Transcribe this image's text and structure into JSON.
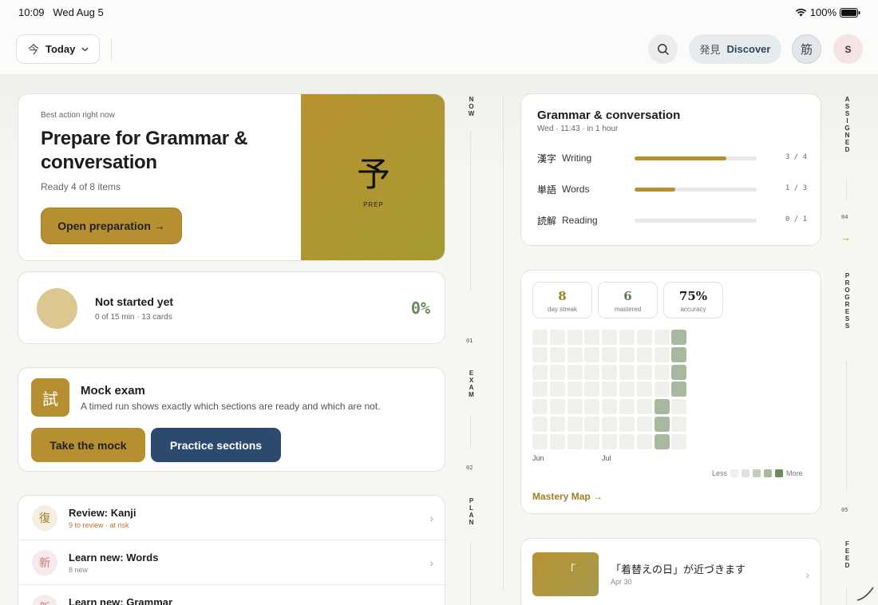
{
  "status": {
    "time": "10:09",
    "date": "Wed Aug 5",
    "battery": "100%"
  },
  "topbar": {
    "today_label": "Today",
    "today_jp": "今",
    "discover_jp": "発見",
    "discover_label": "Discover",
    "kanji_button": "筋",
    "avatar_initial": "S"
  },
  "prep": {
    "eyebrow": "Best action right now",
    "title": "Prepare for Grammar & conversation",
    "subtitle": "Ready 4 of 8 items",
    "button": "Open preparation →",
    "tile_kanji": "予",
    "tile_label": "PREP"
  },
  "progress_status": {
    "title": "Not started yet",
    "subtitle": "0 of 15 min · 13 cards",
    "percent": "0%"
  },
  "mock": {
    "icon": "試",
    "title": "Mock exam",
    "subtitle": "A timed run shows exactly which sections are ready and which are not.",
    "primary_button": "Take the mock",
    "secondary_button": "Practice sections"
  },
  "plan": {
    "items": [
      {
        "icon": "復",
        "title": "Review: Kanji",
        "subtitle": "9 to review · at risk"
      },
      {
        "icon": "新",
        "title": "Learn new: Words",
        "subtitle": "8 new"
      },
      {
        "icon": "新",
        "title": "Learn new: Grammar",
        "subtitle": ""
      }
    ]
  },
  "rails": {
    "now": "NOW",
    "now_num": "01",
    "exam": "EXAM",
    "exam_num": "02",
    "plan": "PLAN",
    "assigned": "ASSIGNED",
    "assigned_num": "04",
    "progress": "PROGRESS",
    "progress_num": "05",
    "feed": "FEED"
  },
  "grammar": {
    "title": "Grammar & conversation",
    "subtitle": "Wed · 11:43 · in 1 hour",
    "rows": [
      {
        "jp": "漢字",
        "en": "Writing",
        "done": 3,
        "total": 4,
        "count": "3 / 4"
      },
      {
        "jp": "単語",
        "en": "Words",
        "done": 1,
        "total": 3,
        "count": "1 / 3"
      },
      {
        "jp": "読解",
        "en": "Reading",
        "done": 0,
        "total": 1,
        "count": "0 / 1"
      }
    ]
  },
  "stats": [
    {
      "value": "8",
      "label": "day streak",
      "color": "#a07d27"
    },
    {
      "value": "6",
      "label": "mastered",
      "color": "#5d7a52"
    },
    {
      "value": "75%",
      "label": "accuracy",
      "color": "#1d1d1d"
    }
  ],
  "heatmap": {
    "months": [
      "Jun",
      "Jul"
    ],
    "legend_less": "Less",
    "legend_more": "More",
    "colors": [
      "#efefec",
      "#e2e3dc",
      "#c3ccbc",
      "#a7b99f",
      "#6c8a5f"
    ],
    "active_cells": [
      [
        8,
        0
      ],
      [
        8,
        1
      ],
      [
        8,
        2
      ],
      [
        8,
        3
      ],
      [
        7,
        4
      ],
      [
        7,
        5
      ],
      [
        7,
        6
      ]
    ]
  },
  "mastery_link": "Mastery Map →",
  "feed": {
    "thumb_text": "「",
    "title": "「着替えの日」が近づきます",
    "date": "Apr 30"
  }
}
